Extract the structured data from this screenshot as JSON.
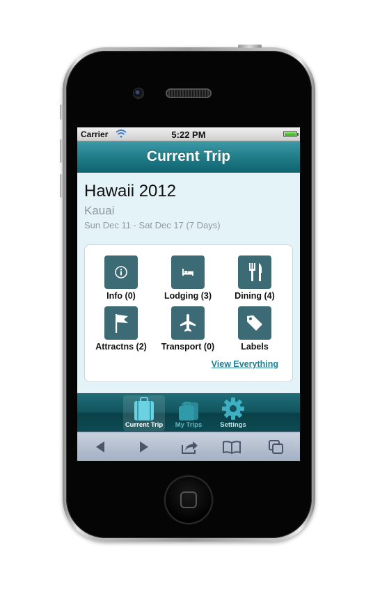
{
  "status_bar": {
    "carrier": "Carrier",
    "time": "5:22 PM"
  },
  "nav": {
    "title": "Current Trip"
  },
  "trip": {
    "name": "Hawaii 2012",
    "location": "Kauai",
    "dates": "Sun Dec 11 - Sat Dec 17 (7 Days)"
  },
  "categories": [
    {
      "label": "Info (0)",
      "icon": "info-icon"
    },
    {
      "label": "Lodging (3)",
      "icon": "bed-icon"
    },
    {
      "label": "Dining (4)",
      "icon": "fork-knife-icon"
    },
    {
      "label": "Attractns (2)",
      "icon": "flag-icon"
    },
    {
      "label": "Transport (0)",
      "icon": "airplane-icon"
    },
    {
      "label": "Labels",
      "icon": "tag-icon"
    }
  ],
  "view_all_label": "View Everything",
  "tabs": [
    {
      "label": "Current Trip",
      "icon": "suitcase-icon",
      "active": true
    },
    {
      "label": "My Trips",
      "icon": "suitcases-icon",
      "active": false
    },
    {
      "label": "Settings",
      "icon": "gear-icon",
      "active": false
    }
  ],
  "browser_toolbar": [
    "back-arrow-icon",
    "forward-arrow-icon",
    "share-icon",
    "bookmarks-icon",
    "tabs-icon"
  ],
  "colors": {
    "accent": "#217d89",
    "tile": "#3c6a75",
    "screen_bg": "#e4f3f7",
    "link": "#1f7f90"
  }
}
